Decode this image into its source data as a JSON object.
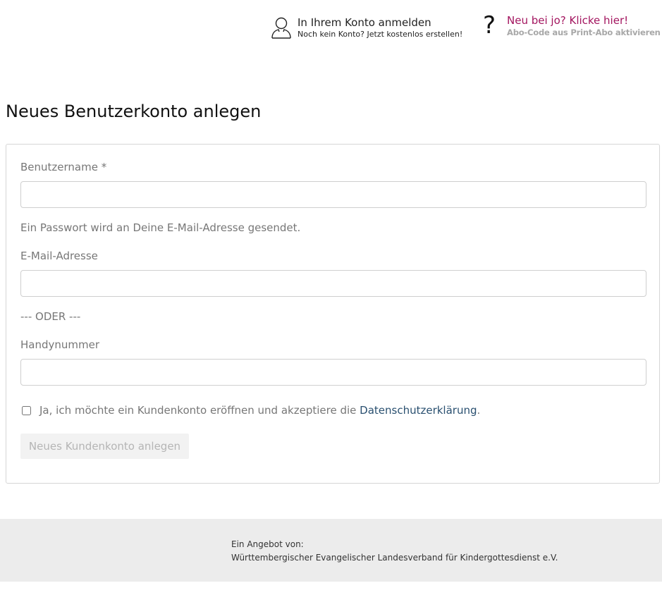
{
  "header": {
    "login": {
      "title": "In Ihrem Konto anmelden",
      "subtitle": "Noch kein Konto? Jetzt kostenlos erstellen!",
      "icon": "user-icon"
    },
    "help": {
      "icon_glyph": "?",
      "title": "Neu bei jo? Klicke hier!",
      "subtitle": "Abo-Code aus Print-Abo aktivieren",
      "accent_color": "#a3155f"
    }
  },
  "page": {
    "title": "Neues Benutzerkonto anlegen"
  },
  "form": {
    "username_label": "Benutzername *",
    "username_value": "",
    "password_hint": "Ein Passwort wird an Deine E-Mail-Adresse gesendet.",
    "email_label": "E-Mail-Adresse",
    "email_value": "",
    "or_separator": "--- ODER ---",
    "phone_label": "Handynummer",
    "phone_value": "",
    "consent_text": "Ja, ich möchte ein Kundenkonto eröffnen und akzeptiere die ",
    "consent_link": "Datenschutzerklärung",
    "consent_end": ".",
    "consent_checked": false,
    "submit_label": "Neues Kundenkonto anlegen"
  },
  "footer": {
    "line1": "Ein Angebot von:",
    "line2": "Württembergischer Evangelischer Landesverband für Kindergottesdienst e.V."
  }
}
